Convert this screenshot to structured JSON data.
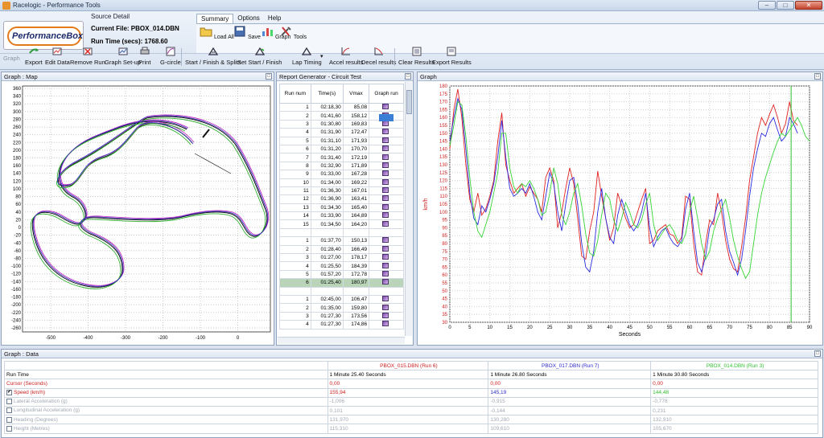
{
  "window": {
    "title": "Racelogic - Performance Tools"
  },
  "logo": {
    "text": "PerformanceBox"
  },
  "source": {
    "header": "Source Detail",
    "current_file": "Current File: PBOX_014.DBN",
    "run_time": "Run Time (secs): 1768.60"
  },
  "menu": {
    "summary": "Summary",
    "options": "Options",
    "help": "Help"
  },
  "menu_tools": {
    "load_all": "Load All",
    "save": "Save",
    "graph": "Graph",
    "tools": "Tools"
  },
  "toolbar": {
    "graph": "Graph",
    "export": "Export",
    "edit_data": "Edit Data",
    "remove_run": "Remove Run",
    "graph_setup": "Graph Set-up",
    "print": "Print",
    "g_circle": "G-circle",
    "start_finish_splits": "Start / Finish & Splits",
    "set_start_finish": "Set Start / Finish",
    "lap_timing": "Lap Timing",
    "accel_results": "Accel results",
    "decel_results": "Decel results",
    "clear_results": "Clear Results",
    "export_results": "Export Results"
  },
  "panels": {
    "map": "Graph : Map",
    "report": "Report Generator - Circuit Test",
    "graph": "Graph",
    "data": "Graph : Data"
  },
  "report": {
    "headers": [
      "Run num",
      "Time(s)",
      "Vmax",
      "Graph run"
    ],
    "groups": [
      [
        [
          "1",
          "02:18,30",
          "85,08"
        ],
        [
          "2",
          "01:41,60",
          "158,12"
        ],
        [
          "3",
          "01:30,80",
          "169,83"
        ],
        [
          "4",
          "01:31,90",
          "172,47"
        ],
        [
          "5",
          "01:31,10",
          "171,93"
        ],
        [
          "6",
          "01:31,20",
          "170,70"
        ],
        [
          "7",
          "01:31,40",
          "172,19"
        ],
        [
          "8",
          "01:32,90",
          "171,89"
        ],
        [
          "9",
          "01:33,00",
          "167,28"
        ],
        [
          "10",
          "01:34,00",
          "169,22"
        ],
        [
          "11",
          "01:36,30",
          "167,01"
        ],
        [
          "12",
          "01:36,90",
          "163,41"
        ],
        [
          "13",
          "01:34,30",
          "165,40"
        ],
        [
          "14",
          "01:33,90",
          "164,89"
        ],
        [
          "15",
          "01:34,50",
          "164,20"
        ]
      ],
      [
        [
          "1",
          "01:37,70",
          "150,13"
        ],
        [
          "2",
          "01:28,40",
          "166,49"
        ],
        [
          "3",
          "01:27,00",
          "178,17"
        ],
        [
          "4",
          "01:25,50",
          "184,39"
        ],
        [
          "5",
          "01:57,20",
          "172,78"
        ],
        [
          "6",
          "01:25,40",
          "180,97"
        ]
      ],
      [
        [
          "1",
          "02:45,00",
          "106,47"
        ],
        [
          "2",
          "01:35,00",
          "159,80"
        ],
        [
          "3",
          "01:27,30",
          "173,56"
        ],
        [
          "4",
          "01:27,30",
          "174,86"
        ]
      ]
    ]
  },
  "map_axes": {
    "y_ticks": [
      "360",
      "340",
      "320",
      "300",
      "280",
      "260",
      "240",
      "220",
      "200",
      "180",
      "160",
      "140",
      "120",
      "100",
      "80",
      "60",
      "40",
      "20",
      "0",
      "-20",
      "-40",
      "-60",
      "-80",
      "-100",
      "-120",
      "-140",
      "-160",
      "-180",
      "-200",
      "-220",
      "-240",
      "-260"
    ],
    "x_ticks": [
      "-500",
      "-400",
      "-300",
      "-200",
      "-100",
      "0"
    ]
  },
  "chart_data": {
    "type": "line",
    "title": "",
    "xlabel": "Seconds",
    "ylabel": "km/h",
    "xlim": [
      0,
      90
    ],
    "ylim": [
      30,
      180
    ],
    "x_ticks": [
      0,
      5,
      10,
      15,
      20,
      25,
      30,
      35,
      40,
      45,
      50,
      55,
      60,
      65,
      70,
      75,
      80,
      85,
      90
    ],
    "y_ticks": [
      30,
      35,
      40,
      45,
      50,
      55,
      60,
      65,
      70,
      75,
      80,
      85,
      90,
      95,
      100,
      105,
      110,
      115,
      120,
      125,
      130,
      135,
      140,
      145,
      150,
      155,
      160,
      165,
      170,
      175,
      180
    ],
    "grid": true,
    "cursor_x": 85.4,
    "series": [
      {
        "color": "#e02020",
        "x": [
          0,
          1,
          2,
          3,
          4,
          5,
          6,
          7,
          8,
          9,
          10,
          11,
          12,
          13,
          14,
          15,
          16,
          17,
          18,
          19,
          20,
          21,
          22,
          23,
          24,
          25,
          26,
          27,
          28,
          29,
          30,
          31,
          32,
          33,
          34,
          35,
          36,
          37,
          38,
          39,
          40,
          41,
          42,
          43,
          44,
          45,
          46,
          47,
          48,
          49,
          50,
          51,
          52,
          53,
          54,
          55,
          56,
          57,
          58,
          59,
          60,
          61,
          62,
          63,
          64,
          65,
          66,
          67,
          68,
          69,
          70,
          71,
          72,
          73,
          74,
          75,
          76,
          77,
          78,
          79,
          80,
          81,
          82,
          83,
          84,
          85,
          86,
          87
        ],
        "y": [
          140,
          165,
          178,
          160,
          130,
          108,
          100,
          112,
          98,
          102,
          110,
          120,
          145,
          163,
          130,
          120,
          112,
          115,
          118,
          110,
          116,
          112,
          108,
          100,
          122,
          128,
          120,
          90,
          100,
          115,
          128,
          118,
          96,
          72,
          70,
          88,
          100,
          126,
          110,
          96,
          82,
          90,
          112,
          104,
          96,
          90,
          92,
          100,
          108,
          115,
          80,
          82,
          88,
          90,
          92,
          86,
          85,
          80,
          84,
          110,
          108,
          80,
          62,
          60,
          80,
          95,
          92,
          112,
          100,
          82,
          70,
          64,
          62,
          78,
          96,
          120,
          135,
          150,
          160,
          155,
          162,
          168,
          160,
          150,
          156,
          170,
          158,
          155
        ]
      },
      {
        "color": "#2a2ae0",
        "x": [
          0,
          1,
          2,
          3,
          4,
          5,
          6,
          7,
          8,
          9,
          10,
          11,
          12,
          13,
          14,
          15,
          16,
          17,
          18,
          19,
          20,
          21,
          22,
          23,
          24,
          25,
          26,
          27,
          28,
          29,
          30,
          31,
          32,
          33,
          34,
          35,
          36,
          37,
          38,
          39,
          40,
          41,
          42,
          43,
          44,
          45,
          46,
          47,
          48,
          49,
          50,
          51,
          52,
          53,
          54,
          55,
          56,
          57,
          58,
          59,
          60,
          61,
          62,
          63,
          64,
          65,
          66,
          67,
          68,
          69,
          70,
          71,
          72,
          73,
          74,
          75,
          76,
          77,
          78,
          79,
          80,
          81,
          82,
          83,
          84,
          85,
          86,
          87
        ],
        "y": [
          145,
          160,
          172,
          165,
          140,
          112,
          96,
          92,
          104,
          100,
          108,
          118,
          135,
          158,
          135,
          115,
          110,
          112,
          115,
          112,
          118,
          110,
          100,
          95,
          110,
          125,
          118,
          100,
          88,
          105,
          120,
          122,
          105,
          80,
          65,
          62,
          75,
          100,
          115,
          96,
          84,
          80,
          98,
          108,
          100,
          92,
          88,
          92,
          100,
          112,
          90,
          78,
          84,
          88,
          90,
          84,
          80,
          78,
          82,
          102,
          112,
          88,
          68,
          62,
          72,
          90,
          95,
          105,
          108,
          88,
          75,
          68,
          60,
          70,
          88,
          110,
          128,
          140,
          150,
          148,
          156,
          160,
          152,
          145,
          148,
          160,
          156,
          150
        ]
      },
      {
        "color": "#36d436",
        "x": [
          0,
          1,
          2,
          3,
          4,
          5,
          6,
          7,
          8,
          9,
          10,
          11,
          12,
          13,
          14,
          15,
          16,
          17,
          18,
          19,
          20,
          21,
          22,
          23,
          24,
          25,
          26,
          27,
          28,
          29,
          30,
          31,
          32,
          33,
          34,
          35,
          36,
          37,
          38,
          39,
          40,
          41,
          42,
          43,
          44,
          45,
          46,
          47,
          48,
          49,
          50,
          51,
          52,
          53,
          54,
          55,
          56,
          57,
          58,
          59,
          60,
          61,
          62,
          63,
          64,
          65,
          66,
          67,
          68,
          69,
          70,
          71,
          72,
          73,
          74,
          75,
          76,
          77,
          78,
          79,
          80,
          81,
          82,
          83,
          84,
          85,
          86,
          87,
          88,
          89,
          90
        ],
        "y": [
          142,
          155,
          170,
          168,
          148,
          122,
          100,
          88,
          84,
          92,
          100,
          112,
          125,
          150,
          150,
          128,
          116,
          112,
          118,
          116,
          120,
          115,
          108,
          98,
          100,
          112,
          128,
          118,
          98,
          92,
          100,
          112,
          118,
          104,
          86,
          74,
          72,
          82,
          98,
          112,
          108,
          95,
          88,
          96,
          106,
          100,
          92,
          90,
          95,
          105,
          112,
          92,
          82,
          86,
          90,
          92,
          88,
          82,
          80,
          86,
          100,
          110,
          96,
          80,
          70,
          75,
          88,
          96,
          102,
          108,
          96,
          82,
          72,
          64,
          58,
          62,
          80,
          98,
          112,
          122,
          130,
          138,
          145,
          150,
          148,
          152,
          156,
          160,
          155,
          148,
          145
        ]
      }
    ]
  },
  "data_table": {
    "runs": [
      "PBOX_015.DBN (Run 6)",
      "PBOX_017.DBN (Run 7)",
      "PBOX_014.DBN (Run 3)"
    ],
    "run_colors": [
      "#d02020",
      "#2a2ad0",
      "#30c030"
    ],
    "rows": [
      {
        "label": "Run Time",
        "values": [
          "1 Minute 25.40 Seconds",
          "1 Minute 26.80 Seconds",
          "1 Minute 30.80 Seconds"
        ],
        "style": "normal",
        "checkbox": false
      },
      {
        "label": "Cursor (Seconds)",
        "values": [
          "0,00",
          "0,00",
          "0,00"
        ],
        "style": "red",
        "checkbox": false
      },
      {
        "label": "Speed (km/h)",
        "values": [
          "155,94",
          "145,19",
          "144,48"
        ],
        "style": "speed",
        "checkbox": true,
        "checked": true
      },
      {
        "label": "Lateral Acceleration (g)",
        "values": [
          "-1,006",
          "-0,915",
          "-0,778"
        ],
        "style": "dim",
        "checkbox": true,
        "checked": false
      },
      {
        "label": "Longitudinal Acceleration (g)",
        "values": [
          "0,101",
          "-0,144",
          "0,231"
        ],
        "style": "dim",
        "checkbox": true,
        "checked": false
      },
      {
        "label": "Heading (Degrees)",
        "values": [
          "131,970",
          "130,280",
          "132,910"
        ],
        "style": "dim",
        "checkbox": true,
        "checked": false
      },
      {
        "label": "Height (Metres)",
        "values": [
          "115,310",
          "109,610",
          "105,670"
        ],
        "style": "dim",
        "checkbox": true,
        "checked": false
      }
    ]
  }
}
